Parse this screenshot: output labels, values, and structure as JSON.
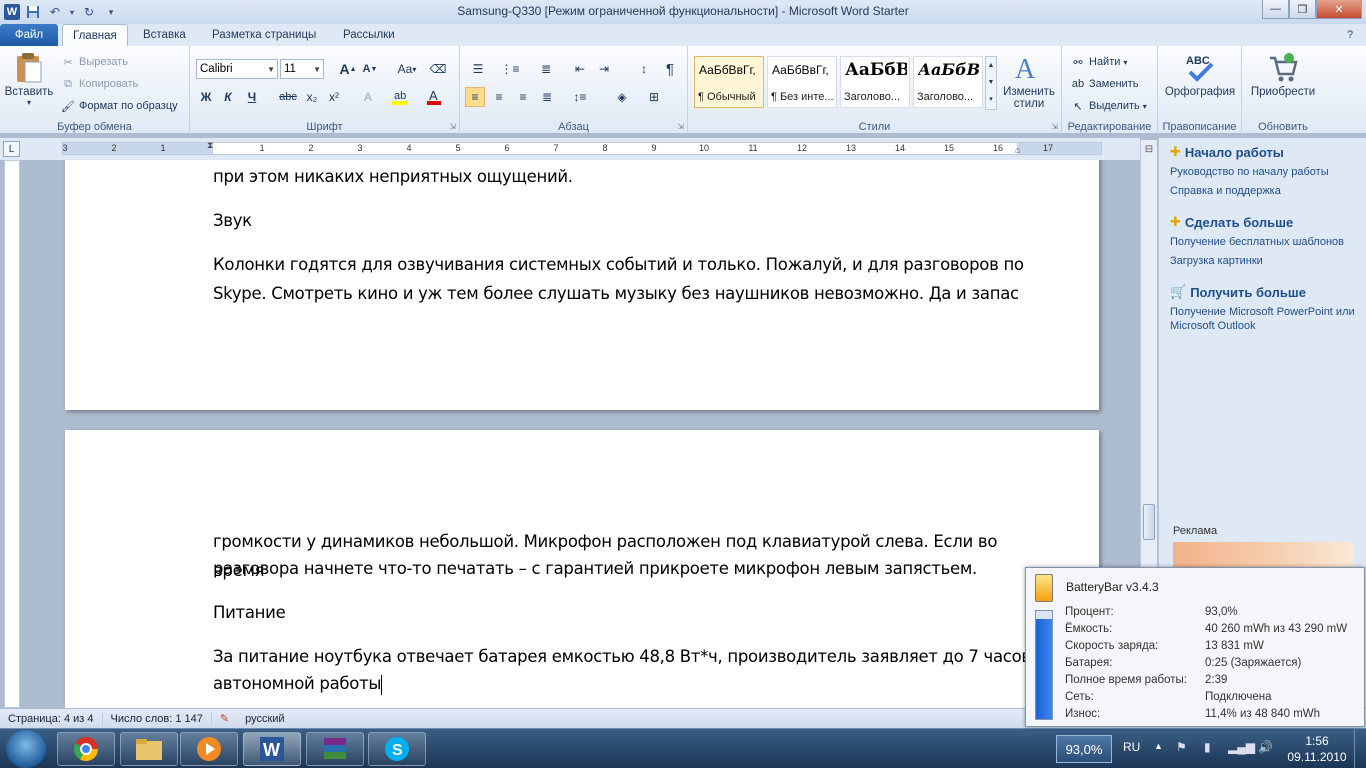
{
  "window": {
    "title": "Samsung-Q330 [Режим ограниченной функциональности]  -  Microsoft Word Starter"
  },
  "tabs": {
    "file": "Файл",
    "items": [
      "Главная",
      "Вставка",
      "Разметка страницы",
      "Рассылки"
    ]
  },
  "clipboard": {
    "paste": "Вставить",
    "cut": "Вырезать",
    "copy": "Копировать",
    "format_painter": "Формат по образцу",
    "label": "Буфер обмена"
  },
  "font": {
    "name": "Calibri",
    "size": "11",
    "label": "Шрифт",
    "bold": "Ж",
    "italic": "К",
    "underline": "Ч",
    "strike": "abc",
    "sub": "x₂",
    "sup": "x²",
    "grow": "A",
    "shrink": "A",
    "case": "Aa"
  },
  "paragraph": {
    "label": "Абзац",
    "pilcrow": "¶"
  },
  "styles": {
    "label": "Стили",
    "items": [
      {
        "sample": "АаБбВвГг,",
        "name": "¶ Обычный"
      },
      {
        "sample": "АаБбВвГг,",
        "name": "¶ Без инте..."
      },
      {
        "sample": "АаБбВ",
        "name": "Заголово..."
      },
      {
        "sample": "АаБбВе",
        "name": "Заголово..."
      }
    ],
    "change": "Изменить стили"
  },
  "editing": {
    "find": "Найти",
    "replace": "Заменить",
    "select": "Выделить",
    "label": "Редактирование"
  },
  "proofing": {
    "spelling": "Орфография",
    "label": "Правописание"
  },
  "update": {
    "purchase": "Приобрести",
    "label": "Обновить"
  },
  "ruler": {
    "numbers": [
      "3",
      "2",
      "1",
      "1",
      "2",
      "3",
      "4",
      "5",
      "6",
      "7",
      "8",
      "9",
      "10",
      "11",
      "12",
      "13",
      "14",
      "15",
      "16",
      "17"
    ]
  },
  "document": {
    "page1": [
      "при этом никаких неприятных ощущений.",
      "Звук",
      "Колонки годятся для озвучивания системных событий и только. Пожалуй, и для разговоров по",
      "Skype. Смотреть кино и уж тем более слушать музыку без наушников невозможно. Да и запас"
    ],
    "page2": [
      "громкости у динамиков небольшой. Микрофон расположен под клавиатурой слева. Если во время",
      "разговора начнете что-то печатать – с гарантией прикроете микрофон левым запястьем.",
      "Питание",
      "За питание ноутбука отвечает батарея емкостью 48,8 Вт*ч, производитель заявляет до 7 часов",
      "автономной работы"
    ]
  },
  "right_pane": {
    "start_header": "Начало работы",
    "start_links": [
      "Руководство по началу работы",
      "Справка и поддержка"
    ],
    "more_header": "Сделать больше",
    "more_links": [
      "Получение бесплатных шаблонов",
      "Загрузка картинки"
    ],
    "get_header": "Получить больше",
    "get_links": [
      "Получение Microsoft PowerPoint или Microsoft Outlook"
    ],
    "ad_label": "Реклама"
  },
  "status": {
    "page": "Страница: 4 из 4",
    "words": "Число слов: 1 147",
    "language": "русский"
  },
  "battery_popup": {
    "title": "BatteryBar v3.4.3",
    "fill_percent": 93,
    "rows": [
      {
        "k": "Процент:",
        "v": "93,0%"
      },
      {
        "k": "Ёмкость:",
        "v": "40 260 mWh из 43 290 mW"
      },
      {
        "k": "Скорость заряда:",
        "v": "13 831 mW"
      },
      {
        "k": "Батарея:",
        "v": "0:25 (Заряжается)"
      },
      {
        "k": "Полное время работы:",
        "v": "2:39"
      },
      {
        "k": "Сеть:",
        "v": "Подключена"
      },
      {
        "k": "Износ:",
        "v": "11,4% из 48 840 mWh"
      }
    ]
  },
  "tray": {
    "battery": "93,0%",
    "lang": "RU",
    "time": "1:56",
    "date": "09.11.2010"
  },
  "colors": {
    "accent": "#2b579a",
    "ribbon_bg": "#dfe9f5",
    "battery_fill": "#1b63d6"
  },
  "taskbar_icons": [
    "chrome-icon",
    "explorer-icon",
    "media-player-icon",
    "word-icon",
    "winrar-icon",
    "skype-icon"
  ]
}
